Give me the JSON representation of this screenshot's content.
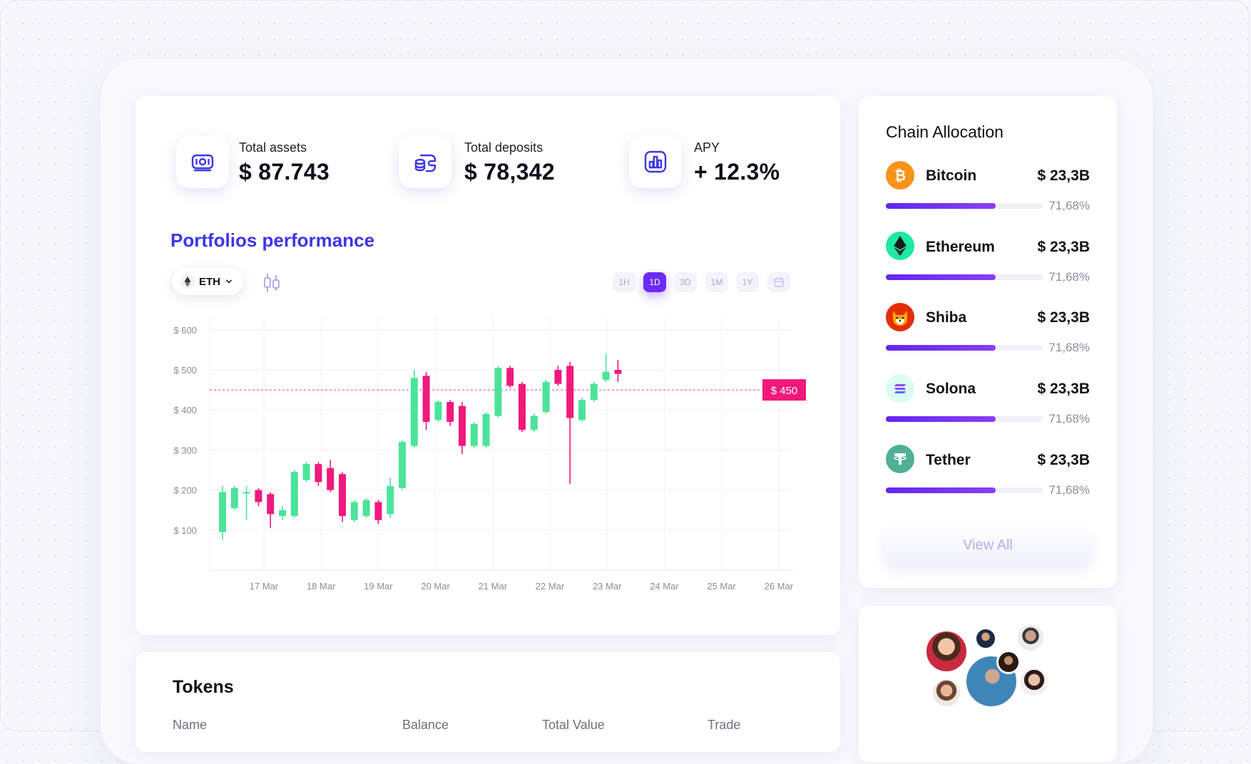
{
  "stats": [
    {
      "label": "Total assets",
      "value": "$ 87.743",
      "icon": "banknote-icon"
    },
    {
      "label": "Total deposits",
      "value": "$ 78,342",
      "icon": "coins-wallet-icon"
    },
    {
      "label": "APY",
      "value": "+ 12.3%",
      "icon": "bar-chart-icon"
    }
  ],
  "performance": {
    "title": "Portfolios performance",
    "asset_selector": "ETH",
    "timeframes": [
      "1H",
      "1D",
      "3D",
      "1M",
      "1Y"
    ],
    "active_timeframe": "1D",
    "price_marker": "$ 450"
  },
  "chart_data": {
    "type": "candlestick",
    "ylabels": [
      "$ 600",
      "$ 500",
      "$ 400",
      "$ 300",
      "$ 200",
      "$ 100"
    ],
    "yticks": [
      600,
      500,
      400,
      300,
      200,
      100
    ],
    "ylim": [
      0,
      620
    ],
    "xlabels": [
      "17 Mar",
      "18 Mar",
      "19 Mar",
      "20 Mar",
      "21 Mar",
      "22 Mar",
      "23 Mar",
      "24 Mar",
      "25 Mar",
      "26 Mar"
    ],
    "reference_line": 450,
    "colors": {
      "up": "#4be39a",
      "down": "#f0197d",
      "reference": "#f0197d"
    },
    "candles": [
      {
        "open": 95,
        "close": 195,
        "high": 210,
        "low": 75
      },
      {
        "open": 155,
        "close": 205,
        "high": 210,
        "low": 150
      },
      {
        "open": 195,
        "close": 195,
        "high": 210,
        "low": 125
      },
      {
        "open": 200,
        "close": 170,
        "high": 205,
        "low": 160
      },
      {
        "open": 190,
        "close": 140,
        "high": 195,
        "low": 105
      },
      {
        "open": 135,
        "close": 150,
        "high": 160,
        "low": 125
      },
      {
        "open": 135,
        "close": 245,
        "high": 250,
        "low": 130
      },
      {
        "open": 225,
        "close": 265,
        "high": 270,
        "low": 220
      },
      {
        "open": 265,
        "close": 220,
        "high": 270,
        "low": 210
      },
      {
        "open": 255,
        "close": 200,
        "high": 275,
        "low": 195
      },
      {
        "open": 240,
        "close": 135,
        "high": 245,
        "low": 120
      },
      {
        "open": 125,
        "close": 170,
        "high": 175,
        "low": 120
      },
      {
        "open": 135,
        "close": 175,
        "high": 180,
        "low": 130
      },
      {
        "open": 170,
        "close": 125,
        "high": 175,
        "low": 115
      },
      {
        "open": 140,
        "close": 210,
        "high": 230,
        "low": 130
      },
      {
        "open": 205,
        "close": 320,
        "high": 325,
        "low": 200
      },
      {
        "open": 310,
        "close": 480,
        "high": 500,
        "low": 305
      },
      {
        "open": 485,
        "close": 370,
        "high": 495,
        "low": 350
      },
      {
        "open": 375,
        "close": 420,
        "high": 425,
        "low": 370
      },
      {
        "open": 420,
        "close": 370,
        "high": 425,
        "low": 360
      },
      {
        "open": 410,
        "close": 310,
        "high": 420,
        "low": 290
      },
      {
        "open": 310,
        "close": 365,
        "high": 370,
        "low": 305
      },
      {
        "open": 310,
        "close": 390,
        "high": 395,
        "low": 305
      },
      {
        "open": 385,
        "close": 505,
        "high": 510,
        "low": 380
      },
      {
        "open": 505,
        "close": 460,
        "high": 510,
        "low": 455
      },
      {
        "open": 465,
        "close": 350,
        "high": 470,
        "low": 345
      },
      {
        "open": 350,
        "close": 385,
        "high": 390,
        "low": 345
      },
      {
        "open": 395,
        "close": 470,
        "high": 475,
        "low": 390
      },
      {
        "open": 500,
        "close": 465,
        "high": 510,
        "low": 460
      },
      {
        "open": 510,
        "close": 380,
        "high": 520,
        "low": 215
      },
      {
        "open": 375,
        "close": 425,
        "high": 430,
        "low": 370
      },
      {
        "open": 425,
        "close": 465,
        "high": 470,
        "low": 420
      },
      {
        "open": 475,
        "close": 495,
        "high": 540,
        "low": 470
      },
      {
        "open": 500,
        "close": 490,
        "high": 525,
        "low": 470
      }
    ]
  },
  "tokens": {
    "title": "Tokens",
    "columns": [
      "Name",
      "Balance",
      "Total Value",
      "Trade"
    ]
  },
  "chain_allocation": {
    "title": "Chain Allocation",
    "items": [
      {
        "name": "Bitcoin",
        "value": "$ 23,3B",
        "percent": "71,68%",
        "fill": 0.6168,
        "logo": "bitcoin-logo-icon",
        "color": "#f7931a"
      },
      {
        "name": "Ethereum",
        "value": "$ 23,3B",
        "percent": "71,68%",
        "fill": 0.6168,
        "logo": "ethereum-logo-icon",
        "color": "#1de9a0"
      },
      {
        "name": "Shiba",
        "value": "$ 23,3B",
        "percent": "71,68%",
        "fill": 0.6168,
        "logo": "shiba-logo-icon",
        "color": "#e42d04"
      },
      {
        "name": "Solona",
        "value": "$ 23,3B",
        "percent": "71,68%",
        "fill": 0.6168,
        "logo": "solana-logo-icon",
        "color": "#dbfbf3"
      },
      {
        "name": "Tether",
        "value": "$ 23,3B",
        "percent": "71,68%",
        "fill": 0.6168,
        "logo": "tether-logo-icon",
        "color": "#50af95"
      }
    ],
    "view_all_label": "View All"
  }
}
